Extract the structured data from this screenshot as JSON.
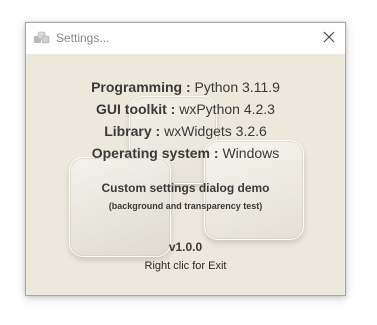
{
  "window": {
    "title": "Settings...",
    "icons": {
      "app": "settings-app-icon",
      "close": "close-icon"
    }
  },
  "info": [
    {
      "label": "Programming :",
      "value": "Python 3.11.9"
    },
    {
      "label": "GUI toolkit :",
      "value": "wxPython 4.2.3"
    },
    {
      "label": "Library :",
      "value": "wxWidgets 3.2.6"
    },
    {
      "label": "Operating system :",
      "value": "Windows"
    }
  ],
  "demo": {
    "title": "Custom settings dialog demo",
    "subtitle": "(background and transparency test)"
  },
  "version": "v1.0.0",
  "hint": "Right clic for Exit",
  "colors": {
    "background": "#ece8dc",
    "titlebar": "#ffffff",
    "text": "#3a3a3a"
  }
}
